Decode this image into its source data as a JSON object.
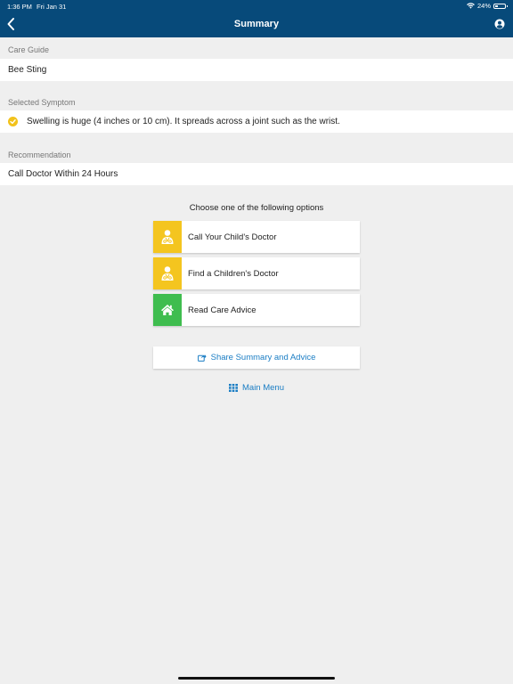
{
  "status_bar": {
    "time": "1:36 PM",
    "date": "Fri Jan 31",
    "battery": "24%"
  },
  "nav": {
    "title": "Summary",
    "back_icon": "chevron-left-icon",
    "user_icon": "user-circle-icon"
  },
  "care_guide": {
    "label": "Care Guide",
    "value": "Bee Sting"
  },
  "selected_symptom": {
    "label": "Selected Symptom",
    "value": "Swelling is huge (4 inches or 10 cm). It spreads across a joint such as the wrist."
  },
  "recommendation": {
    "label": "Recommendation",
    "value": "Call Doctor Within 24 Hours"
  },
  "options": {
    "title": "Choose one of the following options",
    "items": [
      {
        "label": "Call Your Child's Doctor",
        "icon": "doctor-icon",
        "color": "#f4c51f"
      },
      {
        "label": "Find a Children's Doctor",
        "icon": "doctor-icon",
        "color": "#f4c51f"
      },
      {
        "label": "Read Care Advice",
        "icon": "home-icon",
        "color": "#3fbd4f"
      }
    ]
  },
  "share": {
    "label": "Share Summary and Advice",
    "icon": "share-icon"
  },
  "main_menu": {
    "label": "Main Menu",
    "icon": "grid-icon"
  },
  "colors": {
    "nav_bg": "#074a7a",
    "accent_blue": "#1a7dc4",
    "check_yellow": "#f2c21b"
  }
}
